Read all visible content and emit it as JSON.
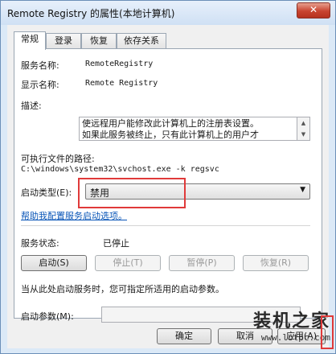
{
  "window": {
    "title": "Remote Registry 的属性(本地计算机)",
    "close_glyph": "✕"
  },
  "tabs": [
    {
      "label": "常规",
      "active": true
    },
    {
      "label": "登录",
      "active": false
    },
    {
      "label": "恢复",
      "active": false
    },
    {
      "label": "依存关系",
      "active": false
    }
  ],
  "general": {
    "service_name_label": "服务名称:",
    "service_name_value": "RemoteRegistry",
    "display_name_label": "显示名称:",
    "display_name_value": "Remote Registry",
    "description_label": "描述:",
    "description_line1": "使远程用户能修改此计算机上的注册表设置。",
    "description_line2": "如果此服务被终止，只有此计算机上的用户才",
    "exe_path_label": "可执行文件的路径:",
    "exe_path_value": "C:\\windows\\system32\\svchost.exe -k regsvc",
    "startup_type_label": "启动类型(E):",
    "startup_type_value": "禁用",
    "help_link": "帮助我配置服务启动选项。",
    "status_label": "服务状态:",
    "status_value": "已停止",
    "buttons": {
      "start": "启动(S)",
      "stop": "停止(T)",
      "pause": "暂停(P)",
      "resume": "恢复(R)"
    },
    "start_params_hint": "当从此处启动服务时，您可指定所适用的启动参数。",
    "start_params_label": "启动参数(M):",
    "start_params_value": ""
  },
  "footer": {
    "ok": "确定",
    "cancel": "取消",
    "apply": "应用(A)"
  },
  "watermark": {
    "logo": "装机之家",
    "url": "www.lotpc.com"
  },
  "colors": {
    "highlight_box": "#e03a3a",
    "link": "#0a56b8",
    "titlebar": "#dbe9f7"
  }
}
